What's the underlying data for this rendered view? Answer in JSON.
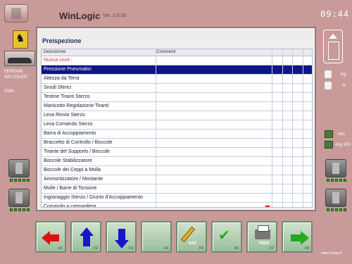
{
  "header": {
    "app_title": "WinLogic",
    "app_version": "Ver. 2.0.00",
    "clock": "09:44"
  },
  "car": {
    "make": "FERRARI",
    "model": "430 COUPE'",
    "year": "2006 -"
  },
  "right_panel": {
    "weight_unit": "Kg",
    "fuel_unit": "%",
    "length_unit": "mm",
    "angle_unit": "deg.100"
  },
  "panel": {
    "title": "Preispezione",
    "columns": [
      "Descrizione",
      "Commenti"
    ],
    "rows": [
      {
        "desc": "Nuova voce :",
        "state": "new"
      },
      {
        "desc": "Pressione Pneumatici",
        "state": "selected"
      },
      {
        "desc": "Altezza da Terra",
        "state": "normal"
      },
      {
        "desc": "Snodi Sferici",
        "state": "normal"
      },
      {
        "desc": "Testine Tiranti Sterzo",
        "state": "normal"
      },
      {
        "desc": "Manicotto Regolazione Tiranti",
        "state": "normal"
      },
      {
        "desc": "Leva Rinvio Sterzo",
        "state": "normal"
      },
      {
        "desc": "Leva Comando Sterzo",
        "state": "normal"
      },
      {
        "desc": "Barra di Accoppiamento",
        "state": "normal"
      },
      {
        "desc": "Braccetto di Controllo / Boccole",
        "state": "normal"
      },
      {
        "desc": "Tirante del Supporto / Boccole",
        "state": "normal"
      },
      {
        "desc": "Boccole Stabilizzatore",
        "state": "normal"
      },
      {
        "desc": "Boccole dei Ceppi a Molla",
        "state": "normal"
      },
      {
        "desc": "Ammortizzatore / Montante",
        "state": "normal"
      },
      {
        "desc": "Molle / Barre di Torsione",
        "state": "normal"
      },
      {
        "desc": "Ingranaggio Sterzo / Giunto d'Accoppiamento",
        "state": "normal"
      },
      {
        "desc": "Comando a cremagliera",
        "state": "normal"
      }
    ]
  },
  "toolbar": {
    "buttons": [
      {
        "key": "F1",
        "icon": "arrow-left-icon",
        "text": ""
      },
      {
        "key": "F2",
        "icon": "arrow-up-icon",
        "text": ""
      },
      {
        "key": "F3",
        "icon": "arrow-down-icon",
        "text": ""
      },
      {
        "key": "F4",
        "icon": "",
        "text": ""
      },
      {
        "key": "F5",
        "icon": "pencil-icon",
        "text": "EDIT"
      },
      {
        "key": "F6",
        "icon": "checklist-icon",
        "text": ""
      },
      {
        "key": "F7",
        "icon": "printer-icon",
        "text": "PRINT"
      },
      {
        "key": "F8",
        "icon": "arrow-right-icon",
        "text": ""
      }
    ]
  },
  "footer": {
    "site": "www.1sosp.it"
  }
}
